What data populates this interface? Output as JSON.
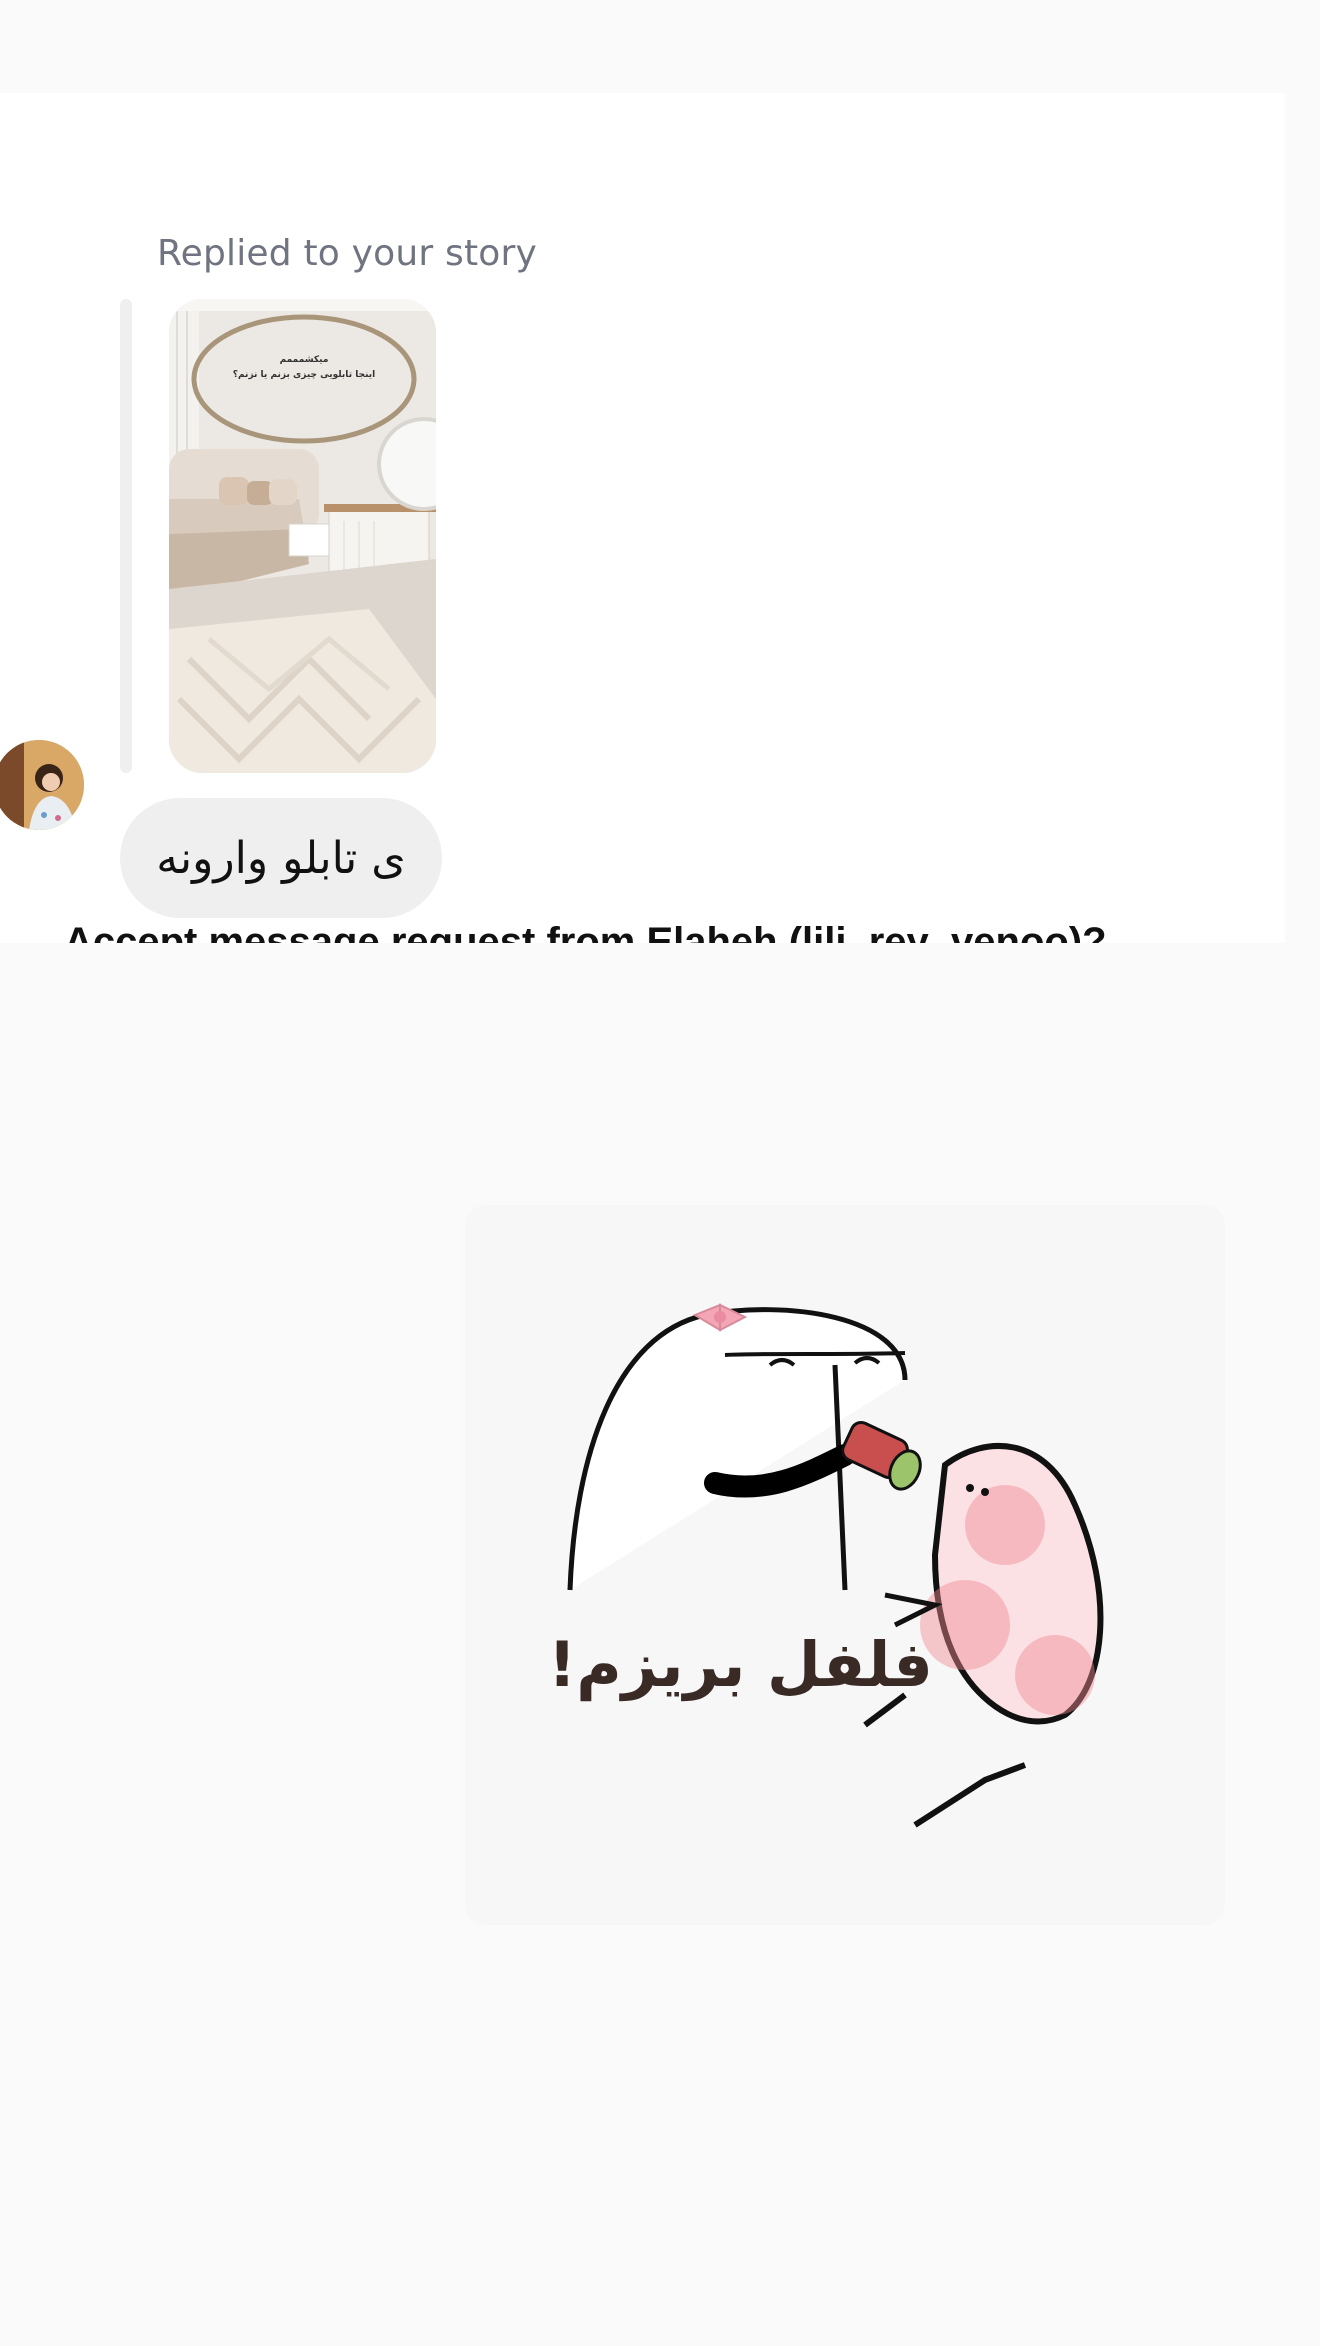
{
  "thread": {
    "story_reply_label": "Replied to your story",
    "story_thumbnail": {
      "overlay_line_1": "میکشمممم",
      "overlay_line_2": "اینجا تابلویی چیزی بزنم یا نزنم؟"
    },
    "message_text": "ی تابلو وارونه",
    "sender_avatar_icon": "avatar-photo"
  },
  "request_banner": {
    "text": "Accept message request from Elaheh (lili_rey_venoo)?"
  },
  "sticker": {
    "caption": "فلفل بریزم!",
    "icon": "sticker-image"
  }
}
